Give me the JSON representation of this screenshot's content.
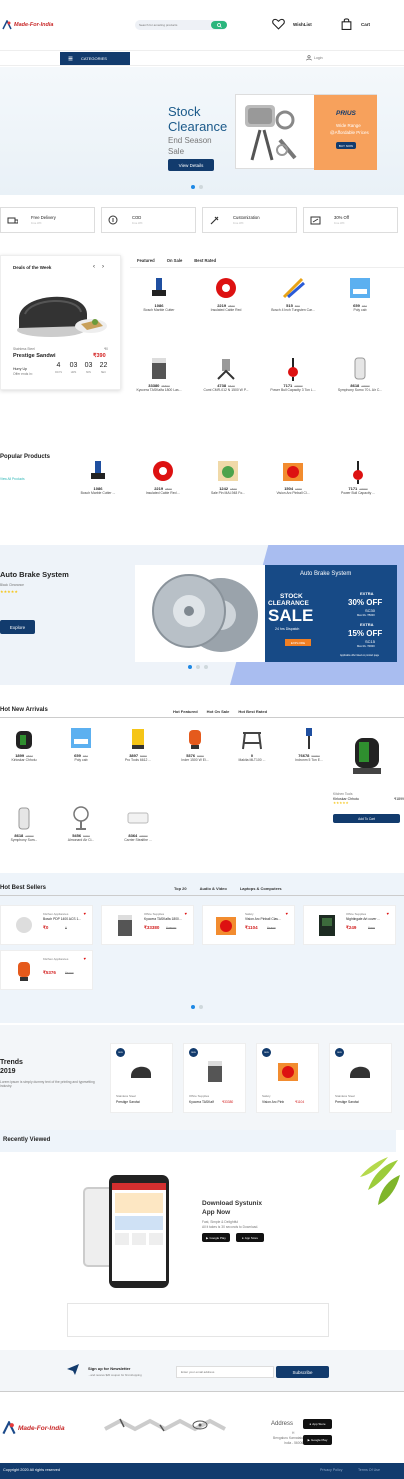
{
  "header": {
    "logo": "Made-For-India",
    "search_placeholder": "Search for amazing products",
    "wishlist": "WishList",
    "cart": "Cart"
  },
  "nav": {
    "categories": "CATEGORIES",
    "login": "Login"
  },
  "hero": {
    "line1": "Stock",
    "line2": "Clearance",
    "line3": "End Season",
    "line4": "Sale",
    "button": "View Details",
    "banner_brand": "PRIUS",
    "banner_text1": "Wide Range",
    "banner_text2": "@Affordable Prices",
    "banner_btn": "BUY NOW"
  },
  "features": [
    {
      "title": "Free Delivery",
      "sub": "Free Wifi"
    },
    {
      "title": "COD",
      "sub": "Free Wifi"
    },
    {
      "title": "Customization",
      "sub": "Free Wifi"
    },
    {
      "title": "30% Off",
      "sub": "Free Wifi"
    }
  ],
  "deal": {
    "heading": "Deals of the Week",
    "category": "Stainless Steel",
    "name": "Prestige Sandwi",
    "old_price": "₹0",
    "price": "₹390",
    "hurry": "Hurry Up",
    "offer": "Offer ends in:",
    "timer": [
      {
        "v": "4",
        "l": "DAYS"
      },
      {
        "v": "03",
        "l": "HRS"
      },
      {
        "v": "03",
        "l": "MIN"
      },
      {
        "v": "22",
        "l": "SEC"
      }
    ]
  },
  "tabs1": [
    "Featured",
    "On Sale",
    "Best Rated"
  ],
  "grid1": [
    {
      "price": "1086",
      "name": "Bosch Marble Cutter"
    },
    {
      "price": "2219",
      "old": "2500",
      "name": "Insulated Cable Red"
    },
    {
      "price": "515",
      "old": "600",
      "name": "Bosch 4 Inch Tungsten Car..."
    },
    {
      "price": "659",
      "old": "774",
      "name": "Poly cab"
    },
    {
      "price": "33380",
      "old": "35500",
      "name": "Kyocera TASKalfa 1800 Las..."
    },
    {
      "price": "4738",
      "old": "5610",
      "name": "Cumi CMR-012 N 1500 W P..."
    },
    {
      "price": "7171",
      "old": "10000",
      "name": "Power Bull Capacity 3 Ton L..."
    },
    {
      "price": "8618",
      "old": "10000",
      "name": "Symphony Sumo 70 L Air C..."
    }
  ],
  "popular": {
    "title": "Popular Products",
    "link": "View All Products"
  },
  "grid2": [
    {
      "price": "1086",
      "name": "Bosch Marble Cutter ..."
    },
    {
      "price": "2219",
      "old": "2500",
      "name": "Insulated Cable Red ..."
    },
    {
      "price": "1242",
      "old": "1500",
      "name": "Sale Pin MAI-948 Fo..."
    },
    {
      "price": "1504",
      "old": "1700",
      "name": "Vision Arc Pinball Cl..."
    },
    {
      "price": "7171",
      "old": "10000",
      "name": "Power Bull Capacity ..."
    }
  ],
  "promo": {
    "title": "Auto Brake System",
    "sub": "Black Clearance",
    "stars": "★★★★★",
    "button": "Explore",
    "banner_title": "Auto Brake System",
    "stock": "STOCK",
    "clearance": "CLEARANCE",
    "sale": "SALE",
    "dispatch": "24 hrs Dispatch",
    "explore": "EXPLORE",
    "extra": "EXTRA",
    "off1": "30% OFF",
    "code1": "SC30",
    "off2": "15% OFF",
    "code2": "SC15",
    "min1": "Max Rs. ₹5000",
    "min2": "Max Rs. ₹3000",
    "note": "Applicable offer listed on product page"
  },
  "arrivals": {
    "title": "Hot New Arrivals",
    "tabs": [
      "Hot Featured",
      "Hot On Sale",
      "Hot Best Rated"
    ],
    "items": [
      {
        "price": "1899",
        "old": "2827",
        "name": "Kirloskar Chhotu"
      },
      {
        "price": "659",
        "old": "774",
        "name": "Poly cab"
      },
      {
        "price": "3897",
        "old": "5000",
        "name": "Pro Tools 6612 ..."
      },
      {
        "price": "5376",
        "old": "6000",
        "name": "Inder 1500 W El..."
      },
      {
        "price": "0",
        "name": "Makita MLT100 ..."
      },
      {
        "price": "76678",
        "old": "90000",
        "name": "Indronm 5 Ton E..."
      },
      {
        "price": "8618",
        "old": "10000",
        "name": "Symphony Sum..."
      },
      {
        "price": "5456",
        "old": "6000",
        "name": "Almonard Air Ci..."
      },
      {
        "price": "8364",
        "old": "10000",
        "name": "Carrier Stealthe ..."
      }
    ],
    "side": {
      "cat": "Kitchen Tools",
      "name": "Kirloskar Chhotu",
      "price": "₹1899",
      "stars": "★★★★★",
      "button": "Add To Cart"
    }
  },
  "sellers": {
    "title": "Hot Best Sellers",
    "tabs": [
      "Top 20",
      "Audio & Video",
      "Laptops & Computers"
    ],
    "items": [
      {
        "cat": "Kitchen Appliances",
        "name": "Bosch PDP 1400 ACS 1...",
        "price": "₹0",
        "old": "₹"
      },
      {
        "cat": "Office Supplies",
        "name": "Kyocera TASKalfa 1800...",
        "price": "₹33380",
        "old": "₹35500"
      },
      {
        "cat": "Safety",
        "name": "Vision Arc Pinball Clas...",
        "price": "₹1104",
        "old": "₹1500"
      },
      {
        "cat": "Office Supplies",
        "name": "Nightingale Art cover ...",
        "price": "₹249",
        "old": "₹300"
      },
      {
        "cat": "Kitchen Appliances",
        "name": "",
        "price": "₹5376",
        "old": "₹6000"
      }
    ]
  },
  "trends": {
    "title1": "Trends",
    "title2": "2019",
    "text": "Lorem ipsum is simply dummy text of the printing and typesetting industry.",
    "items": [
      {
        "cat": "Stainless Steel",
        "name": "Prestige Sandwi",
        "price": "",
        "badge": "NEW"
      },
      {
        "cat": "Office Supplies",
        "name": "Kyocera TASKalf",
        "price": "₹33380",
        "badge": "NEW"
      },
      {
        "cat": "Safety",
        "name": "Vision Arc Pinb",
        "price": "₹1104",
        "badge": "NEW"
      },
      {
        "cat": "Stainless Steel",
        "name": "Prestige Sandwi",
        "price": "",
        "badge": "NEW"
      }
    ]
  },
  "recent": {
    "title": "Recently Viewed"
  },
  "app": {
    "title1": "Download Systunix",
    "title2": "App Now",
    "sub1": "Fast, Simple & Delightful",
    "sub2": "All it takes is 30 seconds to Download.",
    "google": "Google Play",
    "apple": "App Store"
  },
  "newsletter": {
    "title": "Sign up for Newsletter",
    "sub": "...and receive $20 coupon for first shopping",
    "placeholder": "Enter your email address",
    "button": "Subscribe"
  },
  "footer": {
    "logo": "Made-For-India",
    "address_title": "Address",
    "address_lines": [
      "H",
      "Bengaluru Karnataka",
      "India - 560068"
    ],
    "copyright": "Copyright 2020 All rights reserved",
    "links": [
      "Privacy Policy",
      "Terms Of Use"
    ]
  }
}
